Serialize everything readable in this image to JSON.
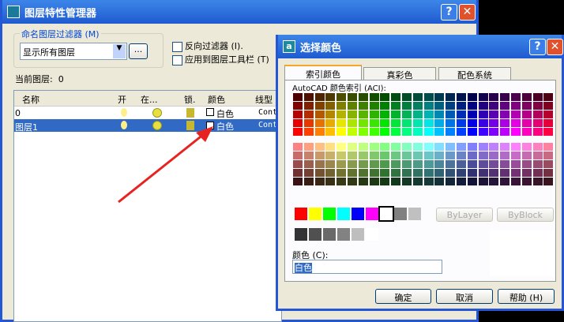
{
  "layer_manager": {
    "title": "图层特性管理器",
    "filter_group": "命名图层过滤器 (M)",
    "filter_value": "显示所有图层",
    "browse": "...",
    "invert": "反向过滤器 (I).",
    "apply": "应用到图层工具栏 (T)",
    "current_label": "当前图层:",
    "current_value": "0",
    "columns": [
      "名称",
      "开",
      "在...",
      "锁.",
      "颜色",
      "线型"
    ],
    "rows": [
      {
        "name": "0",
        "color": "白色",
        "linetype": "Cont"
      },
      {
        "name": "图层1",
        "color": "白色",
        "linetype": "Cont"
      }
    ]
  },
  "color_dialog": {
    "title": "选择颜色",
    "tabs": [
      "索引颜色",
      "真彩色",
      "配色系统"
    ],
    "aci_label": "AutoCAD 颜色索引 (ACI):",
    "bylayer": "ByLayer",
    "byblock": "ByBlock",
    "color_label": "颜色 (C):",
    "color_value": "白色",
    "ok": "确定",
    "cancel": "取消",
    "help": "帮助 (H)",
    "std_colors": [
      "#ff0000",
      "#ffff00",
      "#00ff00",
      "#00ffff",
      "#0000ff",
      "#ff00ff",
      "#ffffff",
      "#808080",
      "#c0c0c0"
    ],
    "gray_colors": [
      "#333333",
      "#505050",
      "#696969",
      "#828282",
      "#bebebe",
      "#ffffff"
    ]
  },
  "accent": "#2456d6",
  "arrow_color": "#e8231f"
}
